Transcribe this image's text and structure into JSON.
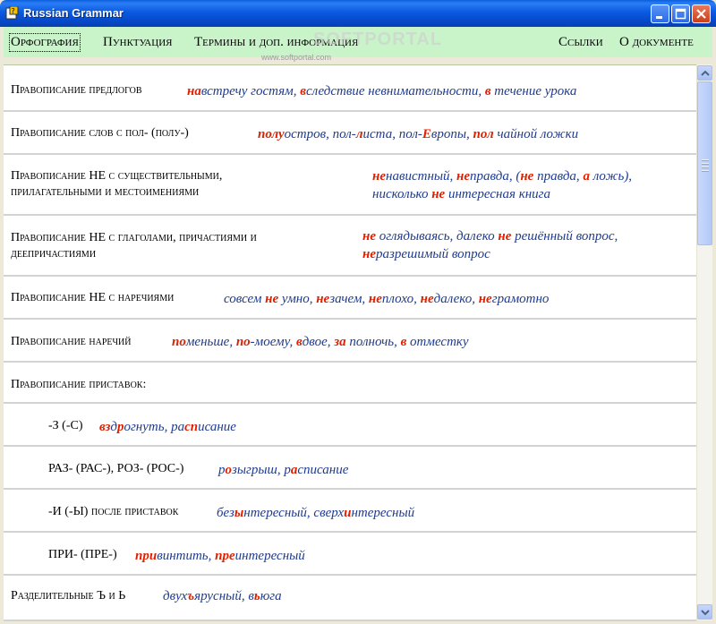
{
  "window": {
    "title": "Russian Grammar"
  },
  "menu": {
    "left": [
      "Орфография",
      "Пунктуация",
      "Термины и доп. информация"
    ],
    "right": [
      "Ссылки",
      "О документе"
    ]
  },
  "watermark": {
    "brand": "SOFTPORTAL",
    "url": "www.softportal.com"
  },
  "rows": [
    {
      "label": [
        "Правописание предлогов"
      ],
      "example": [
        [
          {
            "t": "на",
            "h": 1
          },
          {
            "t": "встречу гостям, "
          },
          {
            "t": "в",
            "h": 1
          },
          {
            "t": "следствие невнимательности, "
          },
          {
            "t": "в",
            "h": 1
          },
          {
            "t": " течение урока"
          }
        ]
      ]
    },
    {
      "label": [
        "Правописание слов с пол- (полу-)"
      ],
      "example": [
        [
          {
            "t": "полу",
            "h": 1
          },
          {
            "t": "остров, пол-"
          },
          {
            "t": "л",
            "h": 1
          },
          {
            "t": "иста, пол-"
          },
          {
            "t": "Е",
            "h": 1
          },
          {
            "t": "вропы, "
          },
          {
            "t": "пол",
            "h": 1
          },
          {
            "t": " чайной ложки"
          }
        ]
      ]
    },
    {
      "label": [
        "Правописание НЕ с существительными,",
        "прилагательными и местоимениями"
      ],
      "example": [
        [
          {
            "t": "не",
            "h": 1
          },
          {
            "t": "навистный, "
          },
          {
            "t": "не",
            "h": 1
          },
          {
            "t": "правда, ("
          },
          {
            "t": "не",
            "h": 1
          },
          {
            "t": " правда, "
          },
          {
            "t": "а",
            "h": 1
          },
          {
            "t": " ложь),"
          }
        ],
        [
          {
            "t": "нисколько "
          },
          {
            "t": "не",
            "h": 1
          },
          {
            "t": " интересная книга"
          }
        ]
      ]
    },
    {
      "label": [
        "Правописание НЕ с глаголами, причастиями и",
        "деепричастиями"
      ],
      "example": [
        [
          {
            "t": "не",
            "h": 1
          },
          {
            "t": " оглядываясь, далеко "
          },
          {
            "t": "не",
            "h": 1
          },
          {
            "t": " решённый вопрос,"
          }
        ],
        [
          {
            "t": "не",
            "h": 1
          },
          {
            "t": "разрешимый вопрос"
          }
        ]
      ]
    },
    {
      "label": [
        "Правописание НЕ с наречиями"
      ],
      "example": [
        [
          {
            "t": "совсем "
          },
          {
            "t": "не",
            "h": 1
          },
          {
            "t": " умно, "
          },
          {
            "t": "не",
            "h": 1
          },
          {
            "t": "зачем, "
          },
          {
            "t": "не",
            "h": 1
          },
          {
            "t": "плохо, "
          },
          {
            "t": "не",
            "h": 1
          },
          {
            "t": "далеко, "
          },
          {
            "t": "не",
            "h": 1
          },
          {
            "t": "грамотно"
          }
        ]
      ]
    },
    {
      "label": [
        "Правописание наречий"
      ],
      "example": [
        [
          {
            "t": "по",
            "h": 1
          },
          {
            "t": "меньше, "
          },
          {
            "t": "по",
            "h": 1
          },
          {
            "t": "-моему, "
          },
          {
            "t": "в",
            "h": 1
          },
          {
            "t": "двое, "
          },
          {
            "t": "за",
            "h": 1
          },
          {
            "t": " полночь, "
          },
          {
            "t": "в",
            "h": 1
          },
          {
            "t": " отместку"
          }
        ]
      ]
    },
    {
      "label": [
        "Правописание приставок:"
      ],
      "example": []
    },
    {
      "label": [
        "-З (-С)"
      ],
      "example": [
        [
          {
            "t": "вз",
            "h": 1
          },
          {
            "t": "д"
          },
          {
            "t": "р",
            "h": 1
          },
          {
            "t": "огнуть, ра"
          },
          {
            "t": "сп",
            "h": 1
          },
          {
            "t": "исание"
          }
        ]
      ]
    },
    {
      "label": [
        "РАЗ- (РАС-), РОЗ- (РОС-)"
      ],
      "example": [
        [
          {
            "t": "р"
          },
          {
            "t": "о",
            "h": 1
          },
          {
            "t": "зыгрыш, р"
          },
          {
            "t": "а",
            "h": 1
          },
          {
            "t": "списание"
          }
        ]
      ]
    },
    {
      "label": [
        "-И (-Ы) после приставок"
      ],
      "example": [
        [
          {
            "t": "без"
          },
          {
            "t": "ы",
            "h": 1
          },
          {
            "t": "нтересный, сверх"
          },
          {
            "t": "и",
            "h": 1
          },
          {
            "t": "нтересный"
          }
        ]
      ]
    },
    {
      "label": [
        "ПРИ- (ПРЕ-)"
      ],
      "example": [
        [
          {
            "t": "при",
            "h": 1
          },
          {
            "t": "винтить, "
          },
          {
            "t": "пре",
            "h": 1
          },
          {
            "t": "интересный"
          }
        ]
      ]
    },
    {
      "label": [
        "Разделительные Ъ и Ь"
      ],
      "example": [
        [
          {
            "t": "двух"
          },
          {
            "t": "ъ",
            "h": 1
          },
          {
            "t": "ярусный, в"
          },
          {
            "t": "ь",
            "h": 1
          },
          {
            "t": "юга"
          }
        ]
      ]
    }
  ]
}
